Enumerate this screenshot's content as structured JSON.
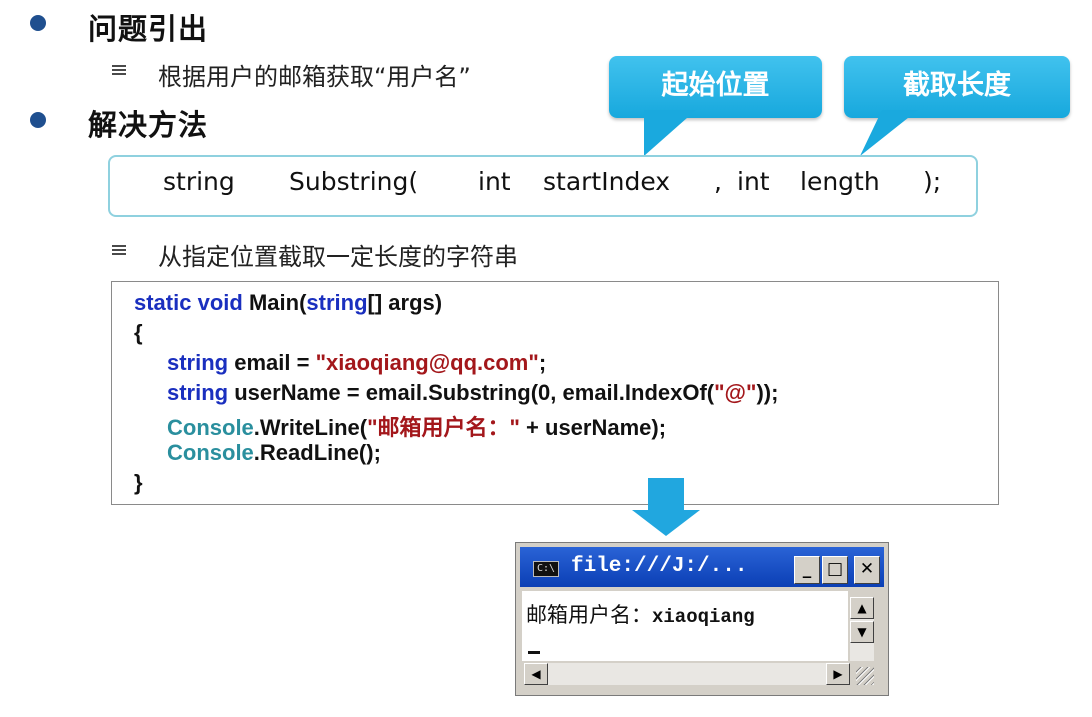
{
  "slide": {
    "heading1": "问题引出",
    "bullet1": "根据用户的邮箱获取“用户名”",
    "heading2": "解决方法",
    "callout_start": "起始位置",
    "callout_length": "截取长度",
    "signature": {
      "ret": "string",
      "method": "Substring(",
      "p1_type": "int",
      "p1_name": "startIndex",
      "comma": ",",
      "p2_type": "int",
      "p2_name": "length",
      "end": ");"
    },
    "bullet2": "从指定位置截取一定长度的字符串"
  },
  "code": {
    "l1_kw1": "static",
    "l1_kw2": "void",
    "l1_name": "Main(",
    "l1_kw3": "string",
    "l1_rest": "[] args)",
    "l2": "{",
    "l3_kw": "string",
    "l3_mid": " email = ",
    "l3_str": "\"xiaoqiang@qq.com\"",
    "l3_end": ";",
    "l4_kw": "string",
    "l4_mid": " userName = email.Substring(0, email.IndexOf(",
    "l4_str": "\"@\"",
    "l4_end": "));",
    "l5_cls": "Console",
    "l5_mid": ".WriteLine(",
    "l5_str": "\"邮箱用户名：\"",
    "l5_end": " + userName);",
    "l6_cls": "Console",
    "l6_end": ".ReadLine();",
    "l7": "}"
  },
  "console": {
    "icon_text": "C:\\",
    "title": "file:///J:/...",
    "btn_min": "_",
    "btn_max": "□",
    "btn_close": "✕",
    "output_label": "邮箱用户名：",
    "output_value": "xiaoqiang",
    "scroll_up": "▲",
    "scroll_down": "▼",
    "scroll_left": "◀",
    "scroll_right": "▶"
  },
  "colors": {
    "bullet_dot": "#1f4f8f",
    "callout": "#1aa9de",
    "keyword": "#1a2fbf",
    "string": "#a3171b",
    "class": "#2a8f9e",
    "titlebar": "#0b3fb5"
  }
}
